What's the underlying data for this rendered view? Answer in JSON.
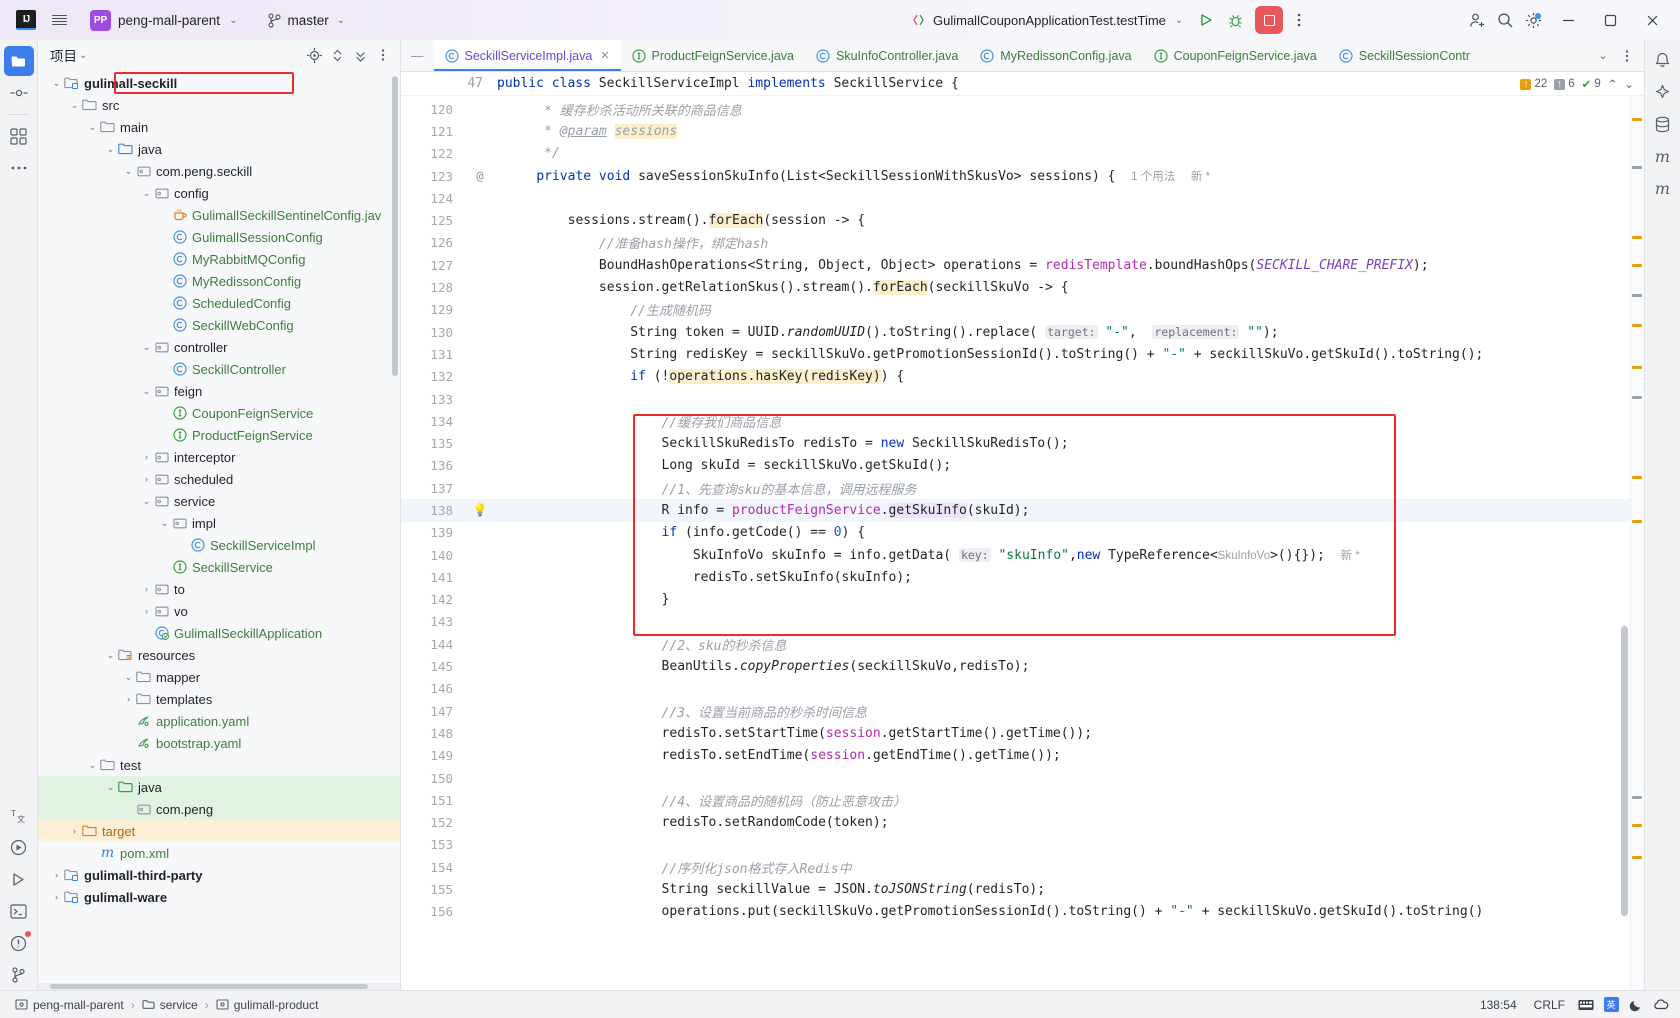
{
  "titlebar": {
    "logo": "IJ",
    "menu_icon": "hamburger-icon",
    "project_badge": "PP",
    "project_name": "peng-mall-parent",
    "branch_icon": "git-branch-icon",
    "branch_name": "master",
    "run_config": "GulimallCouponApplicationTest.testTime",
    "run_label": "run-button",
    "debug_label": "debug-button",
    "stop_label": "stop-button",
    "more_label": "more-actions-button",
    "add_user_label": "add-user-button",
    "search_label": "search-everywhere-button",
    "settings_label": "settings-button",
    "minimize": "–",
    "maximize": "☐",
    "close": "✕"
  },
  "left_toolstrip": [
    {
      "name": "project-tool-window",
      "icon": "folder-icon",
      "active": true
    },
    {
      "name": "commit-tool-window",
      "icon": "commit-icon",
      "active": false
    },
    {
      "name": "structure-tool-window",
      "icon": "structure-icon",
      "active": false
    },
    {
      "name": "more-tool-windows",
      "icon": "ellipsis-icon",
      "active": false
    }
  ],
  "left_toolstrip_bottom": [
    {
      "name": "translate-tool-window",
      "icon": "translate-icon"
    },
    {
      "name": "run-anything",
      "icon": "run-circle-icon"
    },
    {
      "name": "run-tool-window",
      "icon": "play-icon"
    },
    {
      "name": "terminal-tool-window",
      "icon": "terminal-icon"
    },
    {
      "name": "problems-tool-window",
      "icon": "warning-circle-icon"
    },
    {
      "name": "version-control-tool-window",
      "icon": "git-icon"
    }
  ],
  "project_panel": {
    "title": "项目",
    "tools": [
      "locate-icon",
      "expand-collapse-icon",
      "collapse-all-icon",
      "options-icon"
    ],
    "tree": [
      {
        "indent": 1,
        "arrow": "v",
        "icon": "module-folder",
        "label": "gulimall-seckill",
        "bold": true,
        "highlight": "redbox"
      },
      {
        "indent": 2,
        "arrow": "v",
        "icon": "folder",
        "label": "src"
      },
      {
        "indent": 3,
        "arrow": "v",
        "icon": "folder",
        "label": "main"
      },
      {
        "indent": 4,
        "arrow": "v",
        "icon": "source-folder-blue",
        "label": "java"
      },
      {
        "indent": 5,
        "arrow": "v",
        "icon": "package",
        "label": "com.peng.seckill"
      },
      {
        "indent": 6,
        "arrow": "v",
        "icon": "package",
        "label": "config"
      },
      {
        "indent": 7,
        "arrow": "",
        "icon": "java-bean",
        "label": "GulimallSeckillSentinelConfig.jav",
        "green": true
      },
      {
        "indent": 7,
        "arrow": "",
        "icon": "class",
        "label": "GulimallSessionConfig",
        "green": true
      },
      {
        "indent": 7,
        "arrow": "",
        "icon": "class",
        "label": "MyRabbitMQConfig",
        "green": true
      },
      {
        "indent": 7,
        "arrow": "",
        "icon": "class",
        "label": "MyRedissonConfig",
        "green": true
      },
      {
        "indent": 7,
        "arrow": "",
        "icon": "class",
        "label": "ScheduledConfig",
        "green": true
      },
      {
        "indent": 7,
        "arrow": "",
        "icon": "class",
        "label": "SeckillWebConfig",
        "green": true
      },
      {
        "indent": 6,
        "arrow": "v",
        "icon": "package",
        "label": "controller"
      },
      {
        "indent": 7,
        "arrow": "",
        "icon": "class",
        "label": "SeckillController",
        "green": true
      },
      {
        "indent": 6,
        "arrow": "v",
        "icon": "package",
        "label": "feign"
      },
      {
        "indent": 7,
        "arrow": "",
        "icon": "interface",
        "label": "CouponFeignService",
        "green": true
      },
      {
        "indent": 7,
        "arrow": "",
        "icon": "interface",
        "label": "ProductFeignService",
        "green": true
      },
      {
        "indent": 6,
        "arrow": ">",
        "icon": "package",
        "label": "interceptor"
      },
      {
        "indent": 6,
        "arrow": ">",
        "icon": "package",
        "label": "scheduled"
      },
      {
        "indent": 6,
        "arrow": "v",
        "icon": "package",
        "label": "service"
      },
      {
        "indent": 7,
        "arrow": "v",
        "icon": "package",
        "label": "impl"
      },
      {
        "indent": 8,
        "arrow": "",
        "icon": "class",
        "label": "SeckillServiceImpl",
        "green": true
      },
      {
        "indent": 7,
        "arrow": "",
        "icon": "interface",
        "label": "SeckillService",
        "green": true
      },
      {
        "indent": 6,
        "arrow": ">",
        "icon": "package",
        "label": "to"
      },
      {
        "indent": 6,
        "arrow": ">",
        "icon": "package",
        "label": "vo"
      },
      {
        "indent": 6,
        "arrow": "",
        "icon": "spring-boot",
        "label": "GulimallSeckillApplication",
        "green": true
      },
      {
        "indent": 4,
        "arrow": "v",
        "icon": "resources-folder",
        "label": "resources"
      },
      {
        "indent": 5,
        "arrow": "v",
        "icon": "folder",
        "label": "mapper"
      },
      {
        "indent": 5,
        "arrow": ">",
        "icon": "folder",
        "label": "templates"
      },
      {
        "indent": 5,
        "arrow": "",
        "icon": "yaml",
        "label": "application.yaml",
        "green": true
      },
      {
        "indent": 5,
        "arrow": "",
        "icon": "yaml",
        "label": "bootstrap.yaml",
        "green": true
      },
      {
        "indent": 3,
        "arrow": "v",
        "icon": "folder",
        "label": "test"
      },
      {
        "indent": 4,
        "arrow": "v",
        "icon": "test-source-folder",
        "label": "java",
        "rowstyle": "sel-green"
      },
      {
        "indent": 5,
        "arrow": "",
        "icon": "package",
        "label": "com.peng",
        "rowstyle": "sel-green"
      },
      {
        "indent": 2,
        "arrow": ">",
        "icon": "excluded-folder",
        "label": "target",
        "rowstyle": "sel-orange"
      },
      {
        "indent": 3,
        "arrow": "",
        "icon": "maven",
        "label": "pom.xml",
        "green": true
      },
      {
        "indent": 1,
        "arrow": ">",
        "icon": "module-folder",
        "label": "gulimall-third-party",
        "bold": true
      },
      {
        "indent": 1,
        "arrow": ">",
        "icon": "module-folder",
        "label": "gulimall-ware",
        "bold": true
      }
    ]
  },
  "editor": {
    "tabs": [
      {
        "label": "SeckillServiceImpl.java",
        "icon": "class",
        "active": true,
        "closable": true
      },
      {
        "label": "ProductFeignService.java",
        "icon": "interface",
        "active": false
      },
      {
        "label": "SkuInfoController.java",
        "icon": "class",
        "active": false
      },
      {
        "label": "MyRedissonConfig.java",
        "icon": "class",
        "active": false
      },
      {
        "label": "CouponFeignService.java",
        "icon": "interface",
        "active": false
      },
      {
        "label": "SeckillSessionContr",
        "icon": "class",
        "active": false
      }
    ],
    "tabs_right_icons": [
      "chevron-down-icon",
      "more-tabs-icon"
    ],
    "breadcrumb": {
      "line_number": "47",
      "code": "public class SeckillServiceImpl implements SeckillService {"
    },
    "inspection_badges": {
      "warnings": "22",
      "weak_warnings": "6",
      "ok": "9"
    },
    "lines": [
      {
        "n": "120",
        "html": "<span class=\"c\">     * 缓存秒杀活动所关联的商品信息</span>"
      },
      {
        "n": "121",
        "html": "<span class=\"c\">     * <u>@param</u> </span><span class=\"hlw c\">sessions</span>"
      },
      {
        "n": "122",
        "html": "<span class=\"c\">     */</span>"
      },
      {
        "n": "123",
        "gutter": "@",
        "html": "    <span class=\"k\">private void </span><span class=\"m\">saveSessionSkuInfo(</span><span class=\"m\">List&lt;SeckillSessionWithSkusVo&gt; sessions) {</span>  <span class=\"usage\">1 个用法</span>  <span class=\"usage\">新 *</span>"
      },
      {
        "n": "124",
        "html": ""
      },
      {
        "n": "125",
        "html": "        <span class=\"m\">sessions.stream().</span><span class=\"hlw\">forEach</span><span class=\"m\">(session -&gt; {</span>"
      },
      {
        "n": "126",
        "html": "            <span class=\"c\">//准备hash操作，绑定hash</span>"
      },
      {
        "n": "127",
        "html": "            <span class=\"m\">BoundHashOperations&lt;String, Object, Object&gt; operations = </span><span class=\"f\">redisTemplate</span><span class=\"m\">.boundHashOps(</span><span class=\"st\">SECKILL_CHARE_PREFIX</span><span class=\"m\">);</span>"
      },
      {
        "n": "128",
        "html": "            <span class=\"m\">session.getRelationSkus().stream().</span><span class=\"hlw\">forEach</span><span class=\"m\">(seckillSkuVo -&gt; {</span>"
      },
      {
        "n": "129",
        "html": "                <span class=\"c\">//生成随机码</span>"
      },
      {
        "n": "130",
        "html": "                <span class=\"m\">String token = UUID.</span><span class=\"it m\">randomUUID</span><span class=\"m\">().toString().replace(</span> <span class=\"par\">target:</span> <span class=\"s\">\"-\"</span><span class=\"m\">,</span>  <span class=\"par\">replacement:</span> <span class=\"s\">\"\"</span><span class=\"m\">);</span>"
      },
      {
        "n": "131",
        "html": "                <span class=\"m\">String redisKey = seckillSkuVo.getPromotionSessionId().toString() + </span><span class=\"s\">\"-\"</span><span class=\"m\"> + seckillSkuVo.getSkuId().toString();</span>"
      },
      {
        "n": "132",
        "html": "                <span class=\"k\">if </span><span class=\"m\">(!</span><span class=\"hlw\">operations.hasKey(redisKey)</span><span class=\"m\">) {</span>"
      },
      {
        "n": "133",
        "html": ""
      },
      {
        "n": "134",
        "html": "                    <span class=\"c\">//缓存我们商品信息</span>"
      },
      {
        "n": "135",
        "html": "                    <span class=\"m\">SeckillSkuRedisTo redisTo = </span><span class=\"k\">new </span><span class=\"m\">SeckillSkuRedisTo();</span>"
      },
      {
        "n": "136",
        "html": "                    <span class=\"m\">Long skuId = seckillSkuVo.getSkuId();</span>"
      },
      {
        "n": "137",
        "html": "                    <span class=\"c\">//1、先查询sku的基本信息，调用远程服务</span>"
      },
      {
        "n": "138",
        "gutter": "bulb",
        "hl": true,
        "html": "                    <span class=\"m\">R info = </span><span class=\"f\">productFeignService</span><span class=\"m\">.</span><span class=\"hlp\">getSkuInfo</span><span class=\"m\">(skuId);</span>"
      },
      {
        "n": "139",
        "html": "                    <span class=\"k\">if </span><span class=\"m\">(info.getCode() == </span><span class=\"n\">0</span><span class=\"m\">) {</span>"
      },
      {
        "n": "140",
        "html": "                        <span class=\"m\">SkuInfoVo skuInfo = info.getData(</span> <span class=\"par\">key:</span> <span class=\"s\">\"skuInfo\"</span><span class=\"m\">,</span><span class=\"k\">new </span><span class=\"m\">TypeReference&lt;</span><span class=\"usage\">SkuInfoVo</span><span class=\"m\">&gt;(){});</span>  <span class=\"usage\">新 *</span>"
      },
      {
        "n": "141",
        "html": "                        <span class=\"m\">redisTo.setSkuInfo(skuInfo);</span>"
      },
      {
        "n": "142",
        "html": "                    <span class=\"m\">}</span>"
      },
      {
        "n": "143",
        "html": ""
      },
      {
        "n": "144",
        "html": "                    <span class=\"c\">//2、sku的秒杀信息</span>"
      },
      {
        "n": "145",
        "html": "                    <span class=\"m\">BeanUtils.</span><span class=\"it m\">copyProperties</span><span class=\"m\">(seckillSkuVo,redisTo);</span>"
      },
      {
        "n": "146",
        "html": ""
      },
      {
        "n": "147",
        "html": "                    <span class=\"c\">//3、设置当前商品的秒杀时间信息</span>"
      },
      {
        "n": "148",
        "html": "                    <span class=\"m\">redisTo.setStartTime(</span><span class=\"f\">session</span><span class=\"m\">.getStartTime().getTime());</span>"
      },
      {
        "n": "149",
        "html": "                    <span class=\"m\">redisTo.setEndTime(</span><span class=\"f\">session</span><span class=\"m\">.getEndTime().getTime());</span>"
      },
      {
        "n": "150",
        "html": ""
      },
      {
        "n": "151",
        "html": "                    <span class=\"c\">//4、设置商品的随机码（防止恶意攻击）</span>"
      },
      {
        "n": "152",
        "html": "                    <span class=\"m\">redisTo.setRandomCode(token);</span>"
      },
      {
        "n": "153",
        "html": ""
      },
      {
        "n": "154",
        "html": "                    <span class=\"c\">//序列化json格式存入Redis中</span>"
      },
      {
        "n": "155",
        "html": "                    <span class=\"m\">String seckillValue = JSON.</span><span class=\"it m\">toJSONString</span><span class=\"m\">(redisTo);</span>"
      },
      {
        "n": "156",
        "html": "                    <span class=\"m\">operations.put(seckillSkuVo.getPromotionSessionId().toString() + </span><span class=\"s\">\"-\"</span><span class=\"m\"> + seckillSkuVo.getSkuId().toString()</span>"
      }
    ]
  },
  "right_toolstrip": [
    {
      "name": "notifications-tool-window",
      "icon": "bell-icon"
    },
    {
      "name": "ai-assistant-tool-window",
      "icon": "ai-icon"
    },
    {
      "name": "database-tool-window",
      "icon": "database-icon"
    },
    {
      "name": "maven-tool-window",
      "icon": "maven-m-icon"
    },
    {
      "name": "bookmarks-tool-window",
      "icon": "m-icon"
    }
  ],
  "statusbar": {
    "breadcrumbs": [
      {
        "icon": "module-icon",
        "label": "peng-mall-parent"
      },
      {
        "icon": "folder-icon",
        "label": "service"
      },
      {
        "icon": "module-icon",
        "label": "gulimall-product"
      }
    ],
    "caret_position": "138:54",
    "line_separator": "CRLF",
    "ime_lang": "英",
    "tray_icons": [
      "keyboard-icon",
      "ime-icon",
      "moon-icon",
      "cloud-icon"
    ]
  }
}
